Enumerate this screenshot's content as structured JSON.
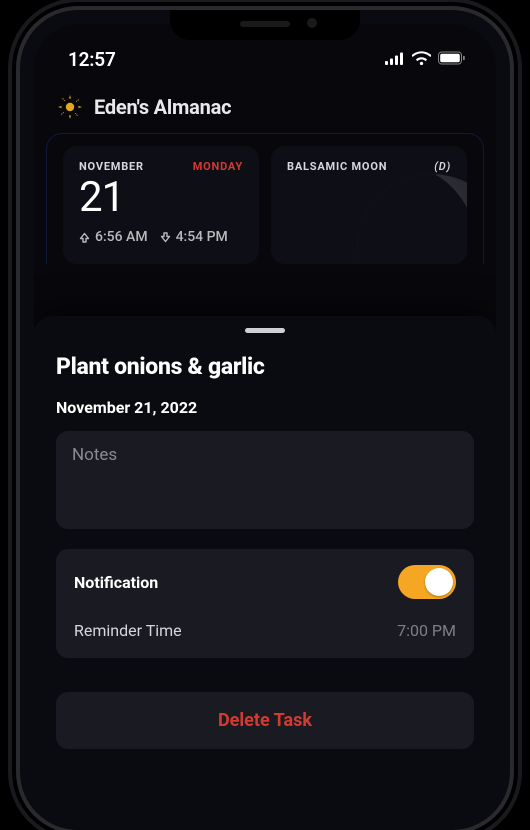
{
  "status": {
    "time": "12:57"
  },
  "header": {
    "title": "Eden's Almanac"
  },
  "dateCard": {
    "month": "NOVEMBER",
    "weekday": "MONDAY",
    "day": "21",
    "sunrise": "6:56 AM",
    "sunset": "4:54 PM"
  },
  "moonCard": {
    "phase": "BALSAMIC MOON",
    "tag": "(D)"
  },
  "task": {
    "title": "Plant onions & garlic",
    "date": "November 21, 2022",
    "notesPlaceholder": "Notes",
    "notificationLabel": "Notification",
    "notificationOn": true,
    "reminderLabel": "Reminder Time",
    "reminderTime": "7:00 PM",
    "deleteLabel": "Delete Task"
  },
  "colors": {
    "accent": "#f5a623",
    "danger": "#d33a30",
    "cardBg": "#1a1b22"
  }
}
